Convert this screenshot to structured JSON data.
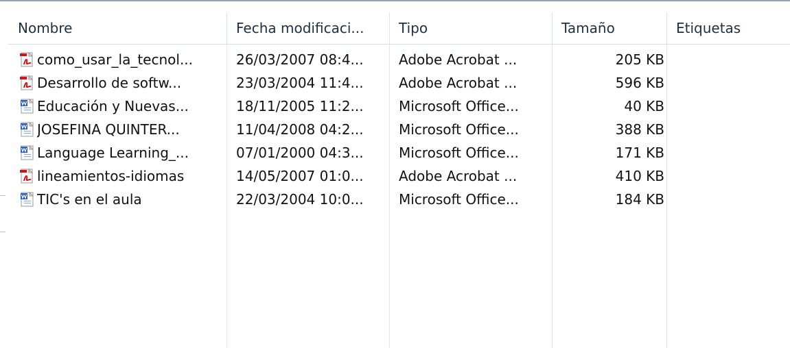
{
  "columns": {
    "name": "Nombre",
    "date": "Fecha modificaci...",
    "type": "Tipo",
    "size": "Tamaño",
    "tags": "Etiquetas"
  },
  "files": [
    {
      "name": "como_usar_la_tecnol...",
      "date": "26/03/2007 08:4...",
      "type": "Adobe Acrobat ...",
      "size": "205 KB",
      "icon": "pdf-file-icon"
    },
    {
      "name": "Desarrollo de softw...",
      "date": "23/03/2004 11:4...",
      "type": "Adobe Acrobat ...",
      "size": "596 KB",
      "icon": "pdf-file-icon"
    },
    {
      "name": "Educación y Nuevas...",
      "date": "18/11/2005 11:2...",
      "type": "Microsoft Office...",
      "size": "40 KB",
      "icon": "word-file-icon"
    },
    {
      "name": "JOSEFINA QUINTER...",
      "date": "11/04/2008 04:2...",
      "type": "Microsoft Office...",
      "size": "388 KB",
      "icon": "word-file-icon"
    },
    {
      "name": "Language Learning_...",
      "date": "07/01/2000 04:3...",
      "type": "Microsoft Office...",
      "size": "171 KB",
      "icon": "word-file-icon"
    },
    {
      "name": "lineamientos-idiomas",
      "date": "14/05/2007 01:0...",
      "type": "Adobe Acrobat ...",
      "size": "410 KB",
      "icon": "pdf-file-icon"
    },
    {
      "name": "TIC's en el aula",
      "date": "22/03/2004 10:0...",
      "type": "Microsoft Office...",
      "size": "184 KB",
      "icon": "word-file-icon"
    }
  ],
  "colors": {
    "header_text": "#1e2f45",
    "separator": "#e2e6ea",
    "pdf_red": "#c9171e",
    "word_blue": "#2f5db3"
  }
}
